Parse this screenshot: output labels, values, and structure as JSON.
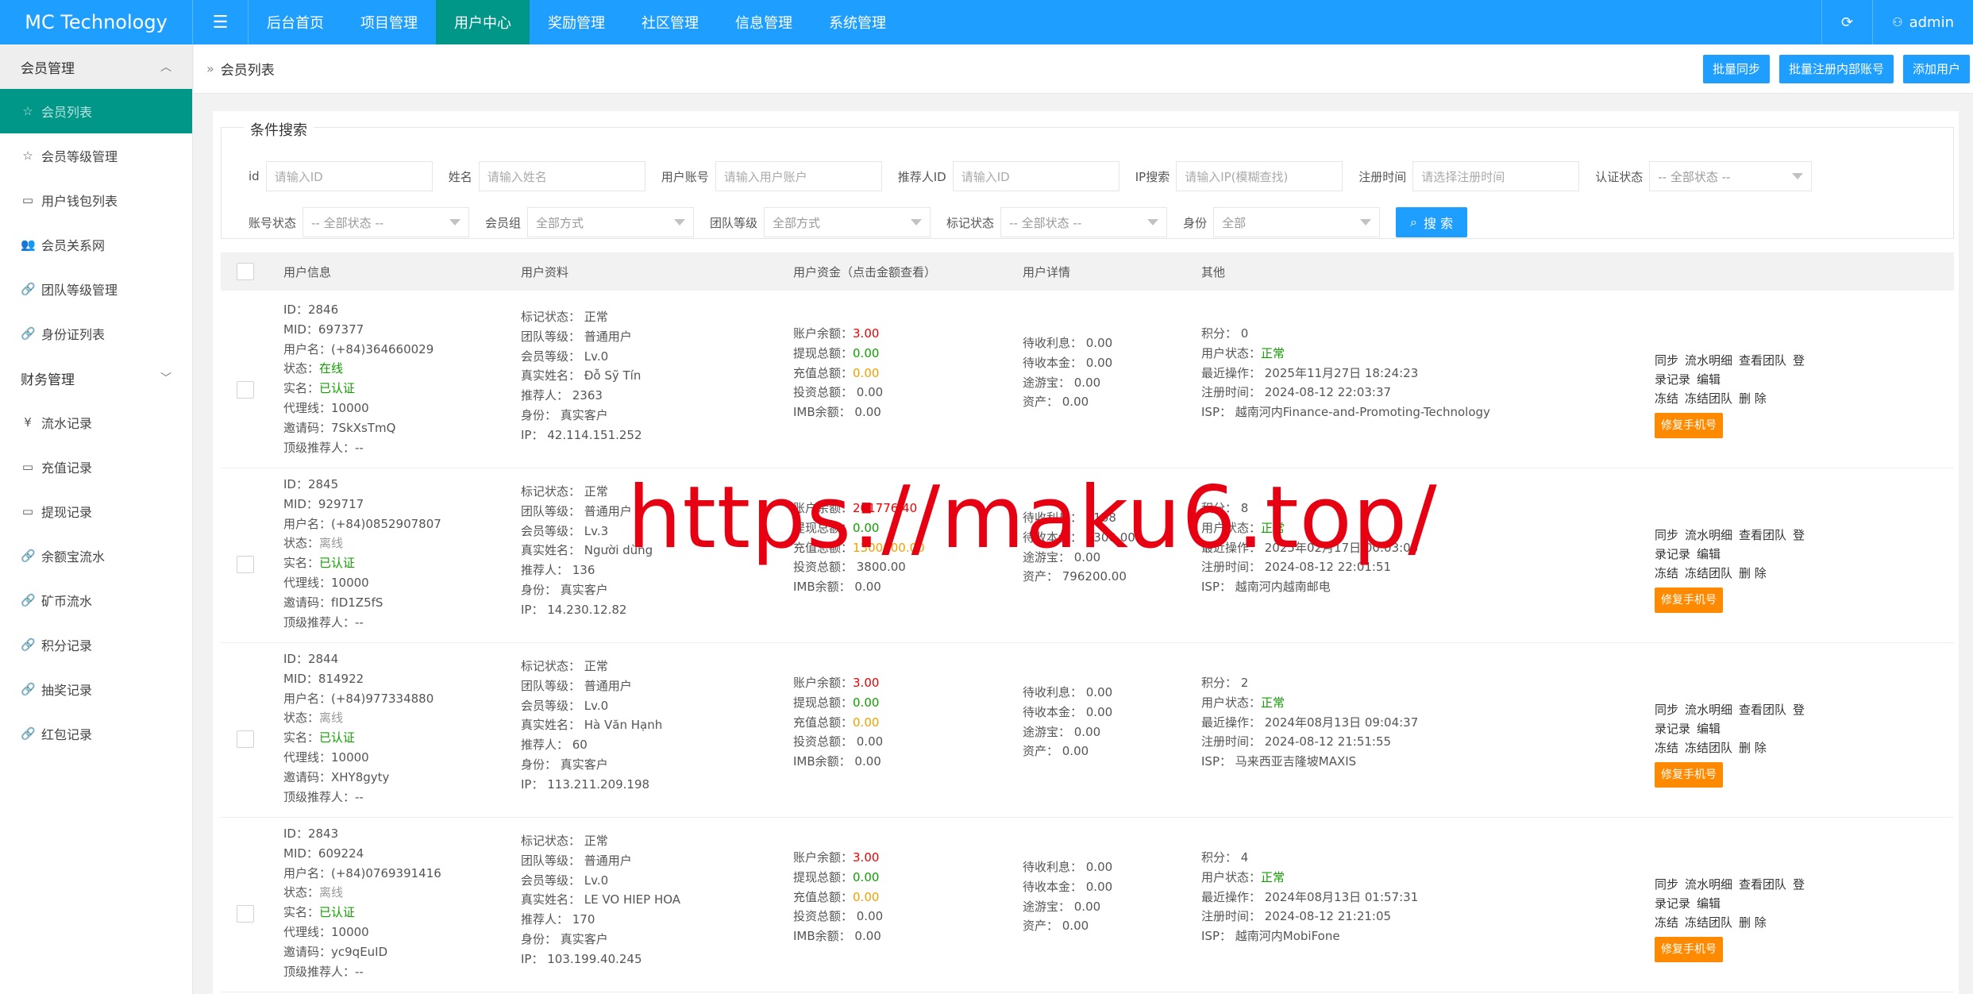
{
  "app": {
    "brand": "MC Technology",
    "user": "admin"
  },
  "nav": [
    {
      "label": "后台首页"
    },
    {
      "label": "项目管理"
    },
    {
      "label": "用户中心"
    },
    {
      "label": "奖励管理"
    },
    {
      "label": "社区管理"
    },
    {
      "label": "信息管理"
    },
    {
      "label": "系统管理"
    }
  ],
  "sidebar": {
    "group1": "会员管理",
    "items1": [
      {
        "label": "会员列表",
        "icon": "☆"
      },
      {
        "label": "会员等级管理",
        "icon": "☆"
      },
      {
        "label": "用户钱包列表",
        "icon": "▭"
      },
      {
        "label": "会员关系网",
        "icon": "👥"
      },
      {
        "label": "团队等级管理",
        "icon": "🔗"
      },
      {
        "label": "身份证列表",
        "icon": "🔗"
      }
    ],
    "group2": "财务管理",
    "items2": [
      {
        "label": "流水记录",
        "icon": "¥"
      },
      {
        "label": "充值记录",
        "icon": "▭"
      },
      {
        "label": "提现记录",
        "icon": "▭"
      },
      {
        "label": "余额宝流水",
        "icon": "🔗"
      },
      {
        "label": "矿币流水",
        "icon": "🔗"
      },
      {
        "label": "积分记录",
        "icon": "🔗"
      },
      {
        "label": "抽奖记录",
        "icon": "🔗"
      },
      {
        "label": "红包记录",
        "icon": "🔗"
      }
    ]
  },
  "breadcrumb": {
    "current": "会员列表"
  },
  "header_actions": {
    "sync": "批量同步",
    "batch_register": "批量注册内部账号",
    "add_user": "添加用户"
  },
  "search": {
    "legend": "条件搜索",
    "id_label": "id",
    "id_ph": "请输入ID",
    "name_label": "姓名",
    "name_ph": "请输入姓名",
    "account_label": "用户账号",
    "account_ph": "请输入用户账户",
    "ref_label": "推荐人ID",
    "ref_ph": "请输入ID",
    "ip_label": "IP搜索",
    "ip_ph": "请输入IP(模糊查找)",
    "reg_label": "注册时间",
    "reg_ph": "请选择注册时间",
    "auth_label": "认证状态",
    "auth_val": "-- 全部状态 --",
    "acct_status_label": "账号状态",
    "acct_status_val": "-- 全部状态 --",
    "group_label": "会员组",
    "group_val": "全部方式",
    "team_label": "团队等级",
    "team_val": "全部方式",
    "mark_label": "标记状态",
    "mark_val": "-- 全部状态 --",
    "identity_label": "身份",
    "identity_val": "全部",
    "button": "搜 索"
  },
  "table": {
    "headers": [
      "用户信息",
      "用户资料",
      "用户资金（点击金额查看）",
      "用户详情",
      "其他"
    ],
    "actions": {
      "sync": "同步",
      "flow": "流水明细",
      "team": "查看团队",
      "login": "登录记录",
      "edit": "编辑",
      "freeze": "冻结",
      "freeze_team": "冻结团队",
      "delete": "删 除",
      "fix_phone": "修复手机号"
    },
    "rows": [
      {
        "id": "ID：2846",
        "mid": "MID：697377",
        "username": "用户名：(+84)364660029",
        "status_k": "状态：",
        "status_v": "在线",
        "status_cls": "online",
        "real_k": "实名：",
        "real_v": "已认证",
        "agent": "代理线：10000",
        "invite": "邀请码：7SkXsTmQ",
        "top": "顶级推荐人：--",
        "mark": "标记状态：  正常",
        "team": "团队等级：  普通用户",
        "level": "会员等级：  Lv.0",
        "realname": "真实姓名：  Đỗ Sỹ Tín",
        "ref": "推荐人：  2363",
        "identity": "身份：  真实客户",
        "ip": "IP：  42.114.151.252",
        "bal_k": "账户余额：",
        "bal_v": "3.00",
        "wd_k": "提现总额：",
        "wd_v": "0.00",
        "dep_k": "充值总额：",
        "dep_v": "0.00",
        "inv": "投资总额：  0.00",
        "imb": "IMB余额：  0.00",
        "d1": "待收利息：  0.00",
        "d2": "待收本金：  0.00",
        "d3": "途游宝：  0.00",
        "d4": "资产：  0.00",
        "points": "积分：  0",
        "ustat_k": "用户状态：",
        "ustat_v": "正常",
        "last": "最近操作：  2025年11月27日 18:24:23",
        "regt": "注册时间：  2024-08-12 22:03:37",
        "isp": "ISP：  越南河内Finance-and-Promoting-Technology"
      },
      {
        "id": "ID：2845",
        "mid": "MID：929717",
        "username": "用户名：(+84)0852907807",
        "status_k": "状态：",
        "status_v": "离线",
        "status_cls": "offline",
        "real_k": "实名：",
        "real_v": "已认证",
        "agent": "代理线：10000",
        "invite": "邀请码：fID1Z5fS",
        "top": "顶级推荐人：--",
        "mark": "标记状态：  正常",
        "team": "团队等级：  普通用户",
        "level": "会员等级：  Lv.3",
        "realname": "真实姓名：  Người dùng",
        "ref": "推荐人：  136",
        "identity": "身份：  真实客户",
        "ip": "IP：  14.230.12.82",
        "bal_k": "账户余额：",
        "bal_v": "201776.40",
        "wd_k": "提现总额：",
        "wd_v": "0.00",
        "dep_k": "充值总额：",
        "dep_v": "1300000.00",
        "inv": "投资总额：  3800.00",
        "imb": "IMB余额：  0.00",
        "d1": "待收利息：  1108",
        "d2": "待收本金：  2300.00",
        "d3": "途游宝：  0.00",
        "d4": "资产：  796200.00",
        "points": "积分：  8",
        "ustat_k": "用户状态：",
        "ustat_v": "正常",
        "last": "最近操作：  2025年02月17日 00:03:03",
        "regt": "注册时间：  2024-08-12 22:01:51",
        "isp": "ISP：  越南河内越南邮电"
      },
      {
        "id": "ID：2844",
        "mid": "MID：814922",
        "username": "用户名：(+84)977334880",
        "status_k": "状态：",
        "status_v": "离线",
        "status_cls": "offline",
        "real_k": "实名：",
        "real_v": "已认证",
        "agent": "代理线：10000",
        "invite": "邀请码：XHY8gyty",
        "top": "顶级推荐人：--",
        "mark": "标记状态：  正常",
        "team": "团队等级：  普通用户",
        "level": "会员等级：  Lv.0",
        "realname": "真实姓名：  Hà Văn Hạnh",
        "ref": "推荐人：  60",
        "identity": "身份：  真实客户",
        "ip": "IP：  113.211.209.198",
        "bal_k": "账户余额：",
        "bal_v": "3.00",
        "wd_k": "提现总额：",
        "wd_v": "0.00",
        "dep_k": "充值总额：",
        "dep_v": "0.00",
        "inv": "投资总额：  0.00",
        "imb": "IMB余额：  0.00",
        "d1": "待收利息：  0.00",
        "d2": "待收本金：  0.00",
        "d3": "途游宝：  0.00",
        "d4": "资产：  0.00",
        "points": "积分：  2",
        "ustat_k": "用户状态：",
        "ustat_v": "正常",
        "last": "最近操作：  2024年08月13日 09:04:37",
        "regt": "注册时间：  2024-08-12 21:51:55",
        "isp": "ISP：  马来西亚吉隆坡MAXIS"
      },
      {
        "id": "ID：2843",
        "mid": "MID：609224",
        "username": "用户名：(+84)0769391416",
        "status_k": "状态：",
        "status_v": "离线",
        "status_cls": "offline",
        "real_k": "实名：",
        "real_v": "已认证",
        "agent": "代理线：10000",
        "invite": "邀请码：yc9qEuID",
        "top": "顶级推荐人：--",
        "mark": "标记状态：  正常",
        "team": "团队等级：  普通用户",
        "level": "会员等级：  Lv.0",
        "realname": "真实姓名：  LE VO HIEP HOA",
        "ref": "推荐人：  170",
        "identity": "身份：  真实客户",
        "ip": "IP：  103.199.40.245",
        "bal_k": "账户余额：",
        "bal_v": "3.00",
        "wd_k": "提现总额：",
        "wd_v": "0.00",
        "dep_k": "充值总额：",
        "dep_v": "0.00",
        "inv": "投资总额：  0.00",
        "imb": "IMB余额：  0.00",
        "d1": "待收利息：  0.00",
        "d2": "待收本金：  0.00",
        "d3": "途游宝：  0.00",
        "d4": "资产：  0.00",
        "points": "积分：  4",
        "ustat_k": "用户状态：",
        "ustat_v": "正常",
        "last": "最近操作：  2024年08月13日 01:57:31",
        "regt": "注册时间：  2024-08-12 21:21:05",
        "isp": "ISP：  越南河内MobiFone"
      }
    ]
  },
  "watermark": "https://maku6.top/",
  "colors": {
    "primary": "#1e9fff",
    "active": "#009688",
    "orange": "#ff8a00",
    "red": "#e00000",
    "green": "#11a000"
  }
}
